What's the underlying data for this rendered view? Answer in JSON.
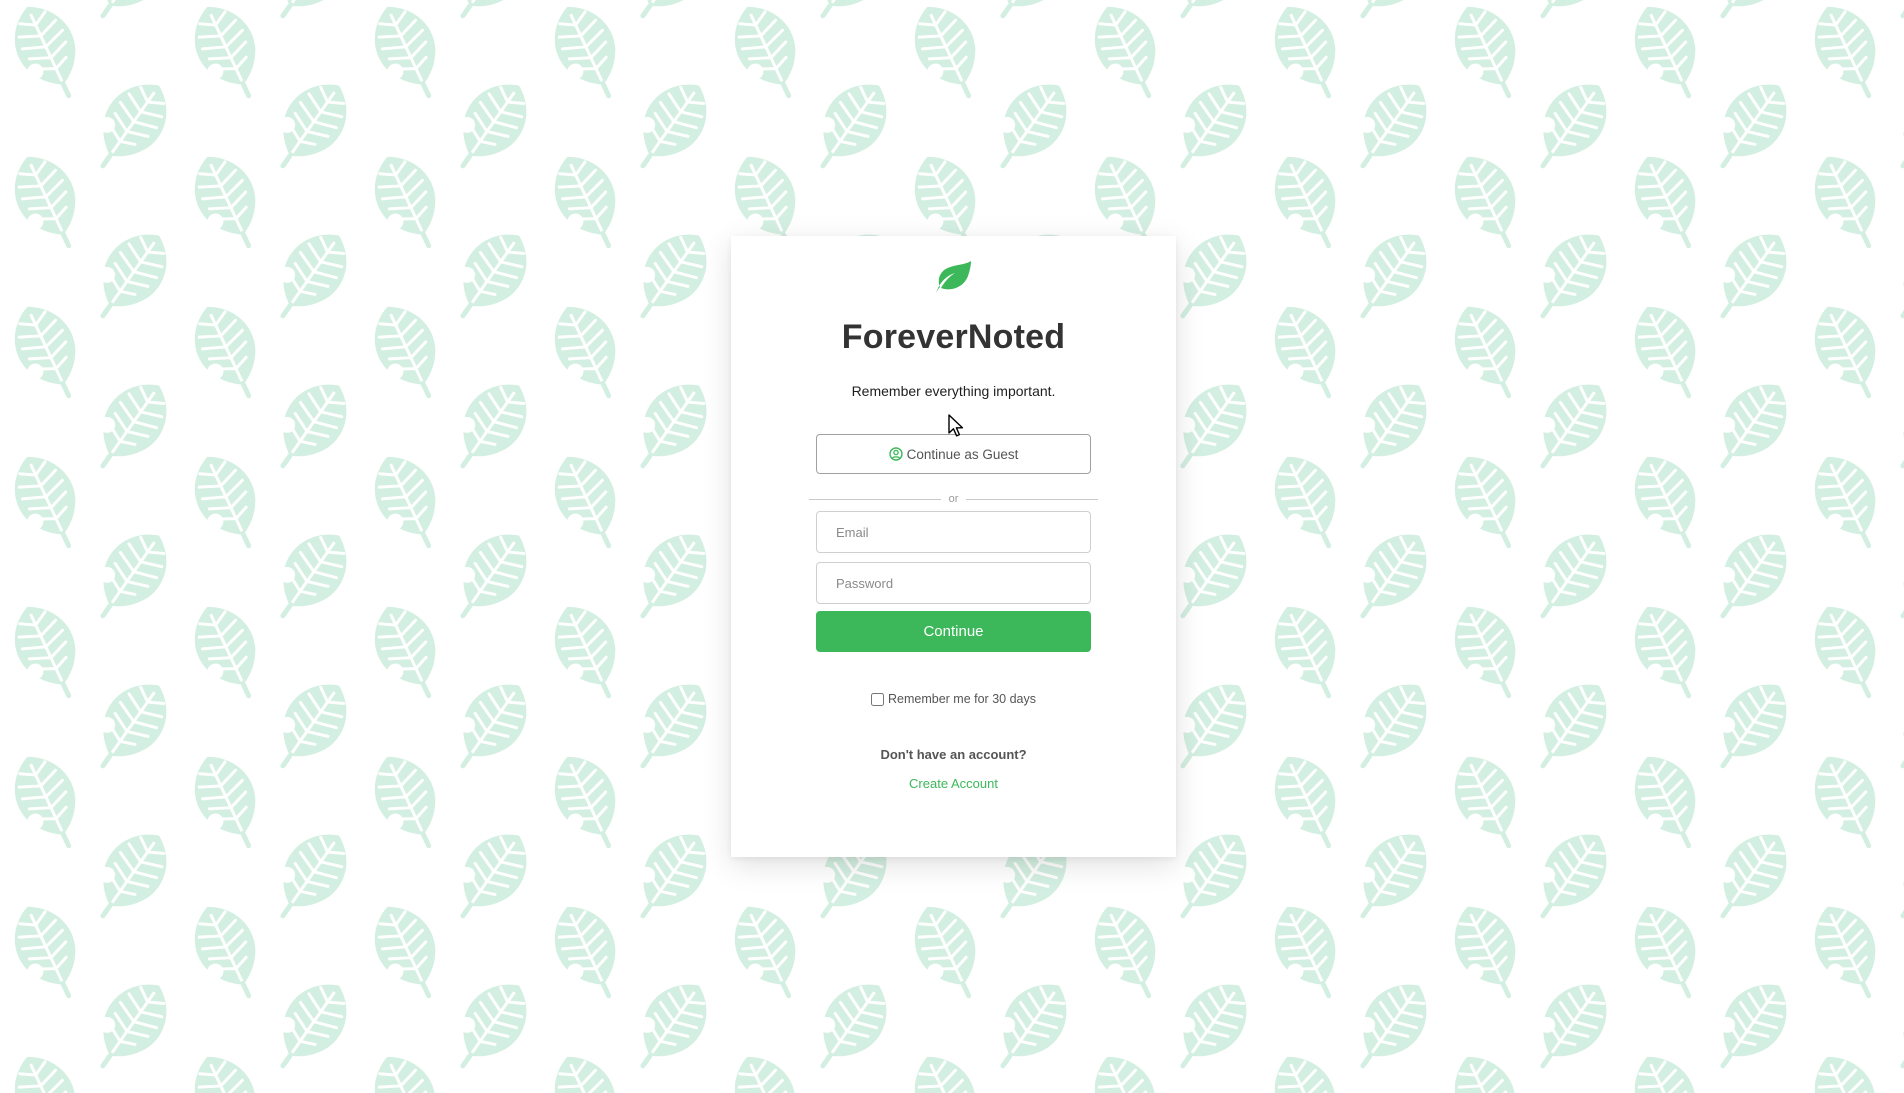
{
  "app": {
    "title": "ForeverNoted",
    "tagline": "Remember everything important."
  },
  "guest": {
    "label": "Continue as Guest",
    "icon": "user-circle-icon"
  },
  "divider": {
    "label": "or"
  },
  "login": {
    "email_placeholder": "Email",
    "password_placeholder": "Password",
    "continue_label": "Continue"
  },
  "remember": {
    "label": "Remember me for 30 days",
    "checked": false
  },
  "signup": {
    "prompt": "Don't have an account?",
    "link_label": "Create Account"
  },
  "colors": {
    "brand": "#3cb85a",
    "background_leaf": "#d3efe1"
  },
  "icons": {
    "logo": "leaf-icon",
    "background": "leaf-pattern",
    "cursor": "mouse-pointer-icon"
  }
}
